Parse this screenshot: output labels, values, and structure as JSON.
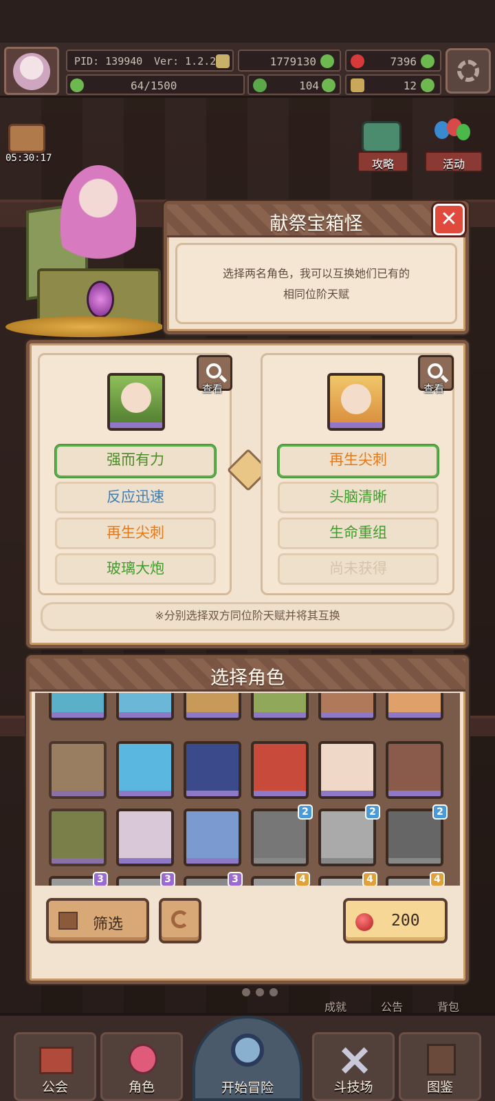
{
  "hud": {
    "pid": "PID: 139940",
    "version": "Ver: 1.2.2.2",
    "gold": "1779130",
    "gems": "7396",
    "energy": "64/1500",
    "clover": "104",
    "keys": "12"
  },
  "top_left": {
    "timer": "05:30:17"
  },
  "top_right": {
    "guide_label": "攻略",
    "event_label": "活动"
  },
  "dialog": {
    "title": "献祭宝箱怪",
    "description_line1": "选择两名角色，我可以互换她们已有的",
    "description_line2": "相同位阶天赋"
  },
  "left_card": {
    "view_label": "查看",
    "traits": [
      {
        "label": "强而有力",
        "color": "green",
        "selected": true
      },
      {
        "label": "反应迅速",
        "color": "blue",
        "selected": false
      },
      {
        "label": "再生尖刺",
        "color": "orange",
        "selected": false
      },
      {
        "label": "玻璃大炮",
        "color": "green",
        "selected": false
      }
    ]
  },
  "right_card": {
    "view_label": "查看",
    "traits": [
      {
        "label": "再生尖刺",
        "color": "orange",
        "selected": true
      },
      {
        "label": "头脑清晰",
        "color": "green",
        "selected": false
      },
      {
        "label": "生命重组",
        "color": "green",
        "selected": false
      },
      {
        "label": "尚未获得",
        "color": "gray",
        "selected": false
      }
    ]
  },
  "note": "※分别选择双方同位阶天赋并将其互换",
  "select_section": {
    "title": "选择角色",
    "row2_badges": [
      "",
      "",
      "",
      "2",
      "2",
      "2"
    ],
    "row3_badges": [
      "3",
      "3",
      "3",
      "4",
      "4",
      "4"
    ],
    "filter_label": "筛选",
    "cost_value": "200"
  },
  "bottom_right_labels": {
    "achievements": "成就",
    "notice": "公告",
    "bag": "背包"
  },
  "bottom_nav": {
    "guild": "公会",
    "character": "角色",
    "adventure": "开始冒险",
    "arena": "斗技场",
    "codex": "图鉴"
  },
  "colors": {
    "frame_brown": "#7a5642",
    "panel_cream": "#f1e3d0",
    "selected_green": "#5aae4a",
    "close_red": "#e04a3c",
    "gem_red": "#d83a3a"
  }
}
